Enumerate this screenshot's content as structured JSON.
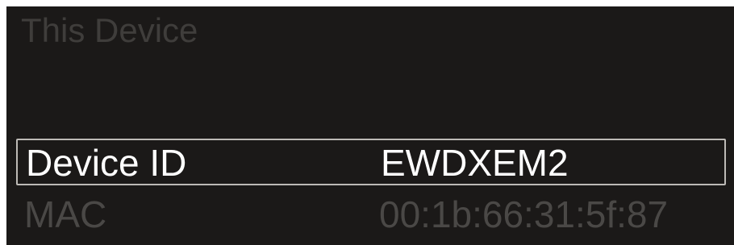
{
  "screen": {
    "title": "This Device",
    "rows": [
      {
        "label": "Device ID",
        "value": "EWDXEM2",
        "selected": true
      },
      {
        "label": "MAC",
        "value": "00:1b:66:31:5f:87",
        "selected": false
      }
    ]
  },
  "colors": {
    "background": "#1b1918",
    "selected_text": "#ffffff",
    "dim_text": "#4a4846",
    "title_text": "#3f3d3b",
    "selection_border": "#bdbab6"
  }
}
